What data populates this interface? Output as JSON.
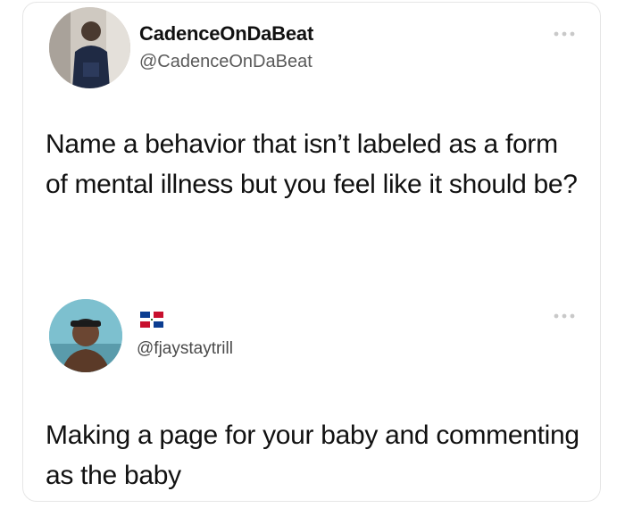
{
  "tweet": {
    "author": {
      "display_name": "CadenceOnDaBeat",
      "handle": "@CadenceOnDaBeat",
      "avatar_icon": "person-photo"
    },
    "text": "Name a behavior that isn’t labeled as a form of mental illness but you feel like it should be?",
    "more_icon": "more-dots-icon"
  },
  "reply": {
    "author": {
      "flag_icon": "dominican-republic-flag",
      "handle": "@fjaystaytrill",
      "avatar_icon": "person-photo"
    },
    "text": "Making a page for your baby and commenting as the baby",
    "more_icon": "more-dots-icon"
  },
  "colors": {
    "text": "#111111",
    "handle": "#5a5a5a",
    "border": "#e6e6e6",
    "flag_blue": "#0b3d91",
    "flag_red": "#c8102e"
  }
}
